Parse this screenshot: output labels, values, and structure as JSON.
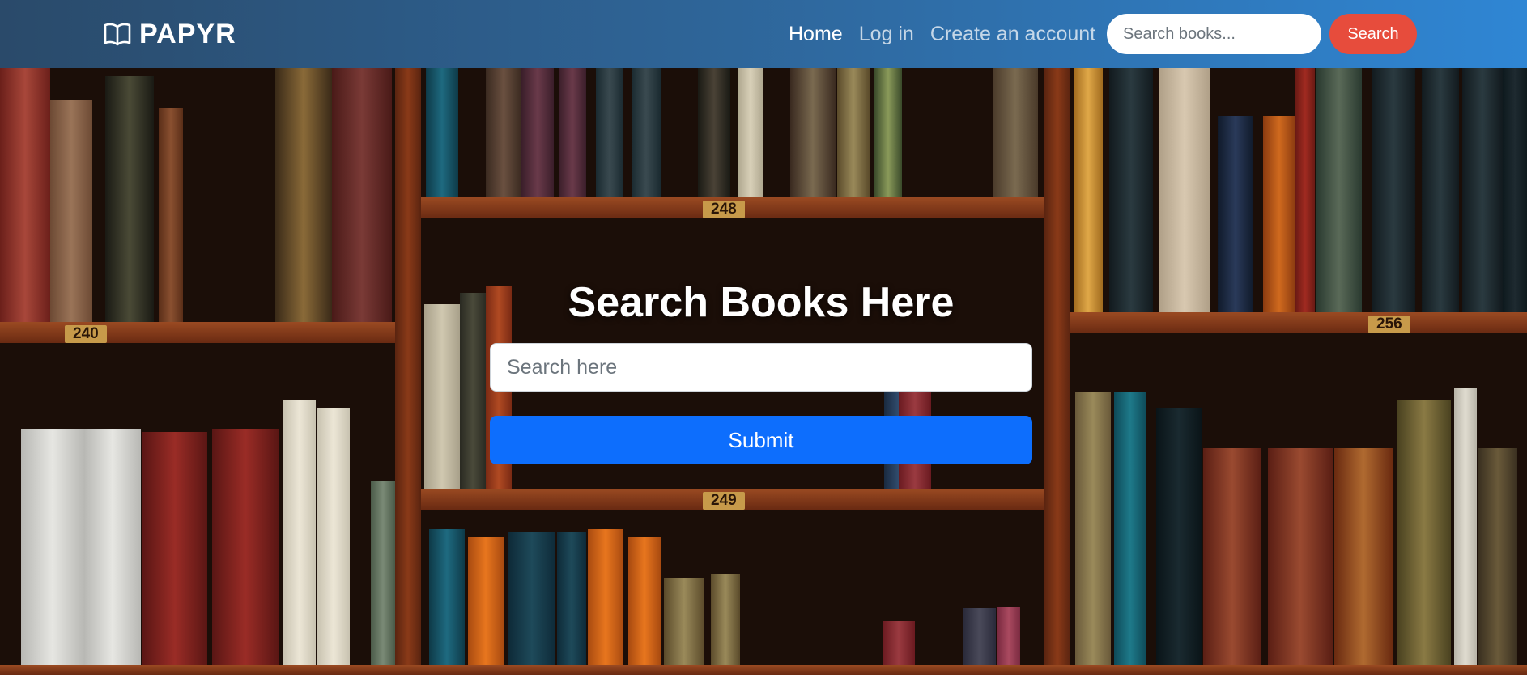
{
  "navbar": {
    "brand": "PAPYR",
    "links": [
      {
        "label": "Home",
        "active": true
      },
      {
        "label": "Log in",
        "active": false
      },
      {
        "label": "Create an account",
        "active": false
      }
    ],
    "search_placeholder": "Search books...",
    "search_button": "Search"
  },
  "hero": {
    "title": "Search Books Here",
    "input_placeholder": "Search here",
    "submit_label": "Submit",
    "shelf_numbers": [
      "240",
      "248",
      "249",
      "256"
    ]
  },
  "colors": {
    "nav_gradient_start": "#2a4a6a",
    "nav_gradient_end": "#2f86d4",
    "search_button": "#e74c3c",
    "submit_button": "#0d6efd"
  }
}
